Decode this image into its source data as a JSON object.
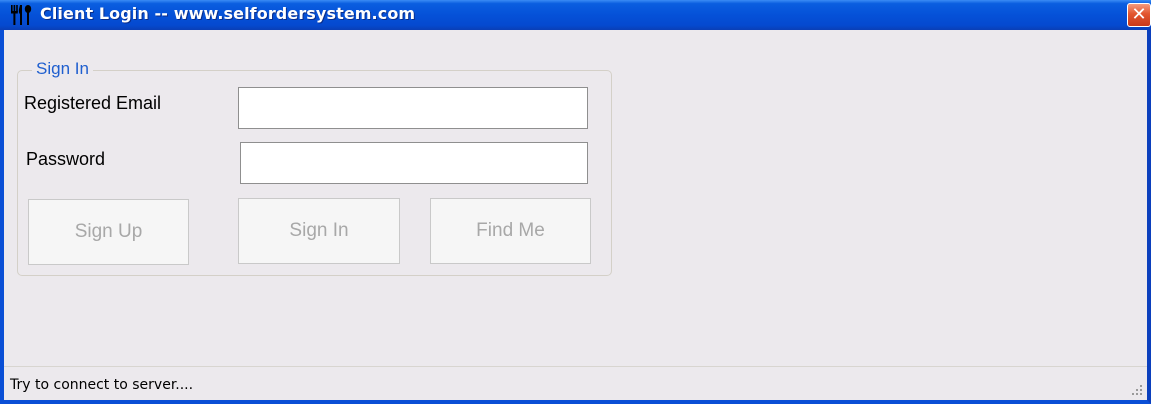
{
  "window": {
    "title": "Client Login -- www.selfordersystem.com",
    "title_icon": "fork-knife-icon",
    "close_label": "✕"
  },
  "sign_in_group": {
    "legend": "Sign In",
    "email_label": "Registered Email",
    "email_value": "",
    "password_label": "Password",
    "password_value": "",
    "buttons": {
      "sign_up": "Sign Up",
      "sign_in": "Sign In",
      "find_me": "Find Me"
    }
  },
  "status_bar": {
    "text": "Try to connect to server...."
  },
  "colors": {
    "titlebar": "#0551d8",
    "legend": "#1f5fcf",
    "window_bg": "#ece9ed",
    "close_button": "#e2552f"
  }
}
